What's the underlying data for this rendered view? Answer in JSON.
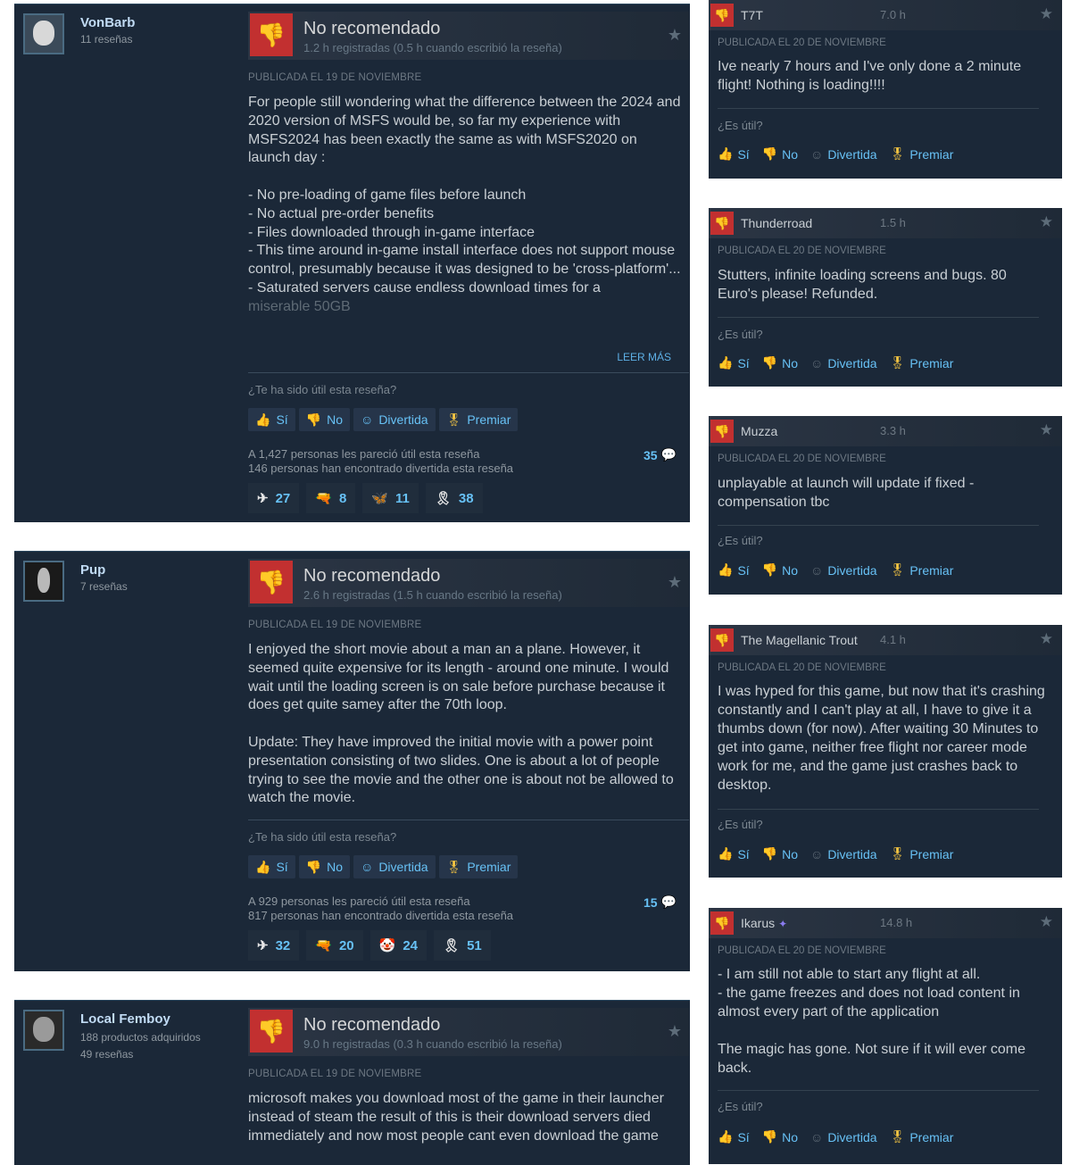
{
  "labels": {
    "not_recommended": "No recomendado",
    "helpful_question": "¿Te ha sido útil esta reseña?",
    "small_helpful_question": "¿Es útil?",
    "yes": "Sí",
    "no": "No",
    "funny": "Divertida",
    "award": "Premiar",
    "read_more": "LEER MÁS"
  },
  "reviews": [
    {
      "author": "VonBarb",
      "author_sub1": "11 reseñas",
      "author_sub2": "",
      "hours": "1.2 h registradas (0.5 h cuando escribió la reseña)",
      "posted": "PUBLICADA EL 19 DE NOVIEMBRE",
      "content": "For people still wondering what the difference between the 2024 and 2020 version of MSFS would be, so far my experience with MSFS2024 has been exactly the same as with MSFS2020 on launch day :\n\n- No pre-loading of game files before launch\n- No actual pre-order benefits\n- Files downloaded through in-game interface\n- This time around in-game install interface does not support mouse control, presumably because it was designed to be 'cross-platform'...\n- Saturated servers cause endless download times for a",
      "content_fade": "miserable 50GB",
      "helpful_stat": "A 1,427 personas les pareció útil esta reseña",
      "funny_stat": "146 personas han encontrado divertida esta reseña",
      "comments": "35",
      "awards": [
        "27",
        "8",
        "11",
        "38"
      ]
    },
    {
      "author": "Pup",
      "author_sub1": "7 reseñas",
      "author_sub2": "",
      "hours": "2.6 h registradas (1.5 h cuando escribió la reseña)",
      "posted": "PUBLICADA EL 19 DE NOVIEMBRE",
      "content": "I enjoyed the short movie about a man an a plane. However, it seemed quite expensive for its length - around one minute. I would wait until the loading screen is on sale before purchase because it does get quite samey after the 70th loop.\n\nUpdate: They have improved the initial movie with a power point presentation consisting of two slides. One is about a lot of people trying to see the movie and the other one is about not be allowed to watch the movie.",
      "helpful_stat": "A 929 personas les pareció útil esta reseña",
      "funny_stat": "817 personas han encontrado divertida esta reseña",
      "comments": "15",
      "awards": [
        "32",
        "20",
        "24",
        "51"
      ]
    },
    {
      "author": "Local Femboy",
      "author_sub1": "188 productos adquiridos",
      "author_sub2": "49 reseñas",
      "hours": "9.0 h registradas (0.3 h cuando escribió la reseña)",
      "posted": "PUBLICADA EL 19 DE NOVIEMBRE",
      "content": "microsoft makes you download most of the game in their launcher instead of steam the result of this is their download servers died immediately and now most people cant even download the game"
    }
  ],
  "side_reviews": [
    {
      "name": "T7T",
      "hours": "7.0 h",
      "posted": "PUBLICADA EL 20 DE NOVIEMBRE",
      "content": "Ive nearly 7 hours and I've only done a 2 minute flight! Nothing is loading!!!!"
    },
    {
      "name": "Thunderroad",
      "hours": "1.5 h",
      "posted": "PUBLICADA EL 20 DE NOVIEMBRE",
      "content": "Stutters, infinite loading screens and bugs. 80 Euro's please! Refunded."
    },
    {
      "name": "Muzza",
      "hours": "3.3 h",
      "posted": "PUBLICADA EL 20 DE NOVIEMBRE",
      "content": "unplayable at launch will update if fixed - compensation tbc"
    },
    {
      "name": "The Magellanic Trout",
      "hours": "4.1 h",
      "posted": "PUBLICADA EL 20 DE NOVIEMBRE",
      "content": "I was hyped for this game, but now that it's crashing constantly and I can't play at all, I have to give it a thumbs down (for now). After waiting 30 Minutes to get into game, neither free flight nor career mode work for me, and the game just crashes back to desktop."
    },
    {
      "name": "Ikarus",
      "hours": "14.8 h",
      "posted": "PUBLICADA EL 20 DE NOVIEMBRE",
      "content": "- I am still not able to start any flight at all.\n- the game freezes and does not load content in almost every part of the application\n\nThe magic has gone. Not sure if it will ever come back."
    }
  ]
}
